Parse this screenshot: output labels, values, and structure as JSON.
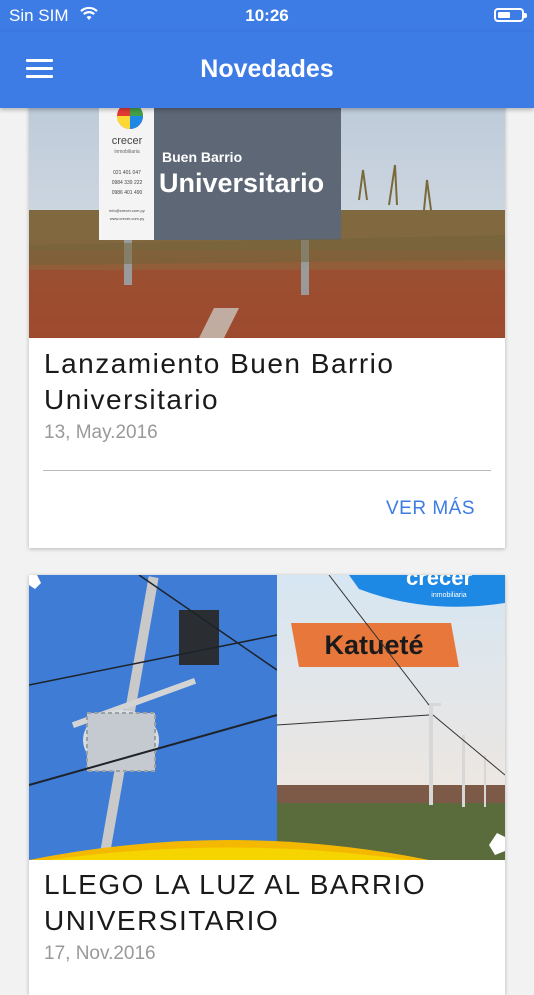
{
  "status_bar": {
    "carrier": "Sin SIM",
    "time": "10:26"
  },
  "header": {
    "title": "Novedades"
  },
  "posts": [
    {
      "image": {
        "sign_brand": "crecer",
        "sign_brand_sub": "inmobiliaria",
        "sign_line1": "Buen Barrio",
        "sign_line2": "Universitario",
        "sign_contacts": [
          "021 401 047",
          "0984 339 222",
          "0986 401 490",
          "info@crecer.com.py",
          "www.crecer.com.py"
        ]
      },
      "title": "Lanzamiento Buen Barrio Universitario",
      "date": "13, May.2016",
      "action_label": "VER MÁS"
    },
    {
      "image": {
        "brand": "crecer",
        "brand_sub": "inmobiliaria",
        "tag": "Katueté"
      },
      "title": "LLEGO LA LUZ AL BARRIO UNIVERSITARIO",
      "date": "17, Nov.2016"
    }
  ]
}
